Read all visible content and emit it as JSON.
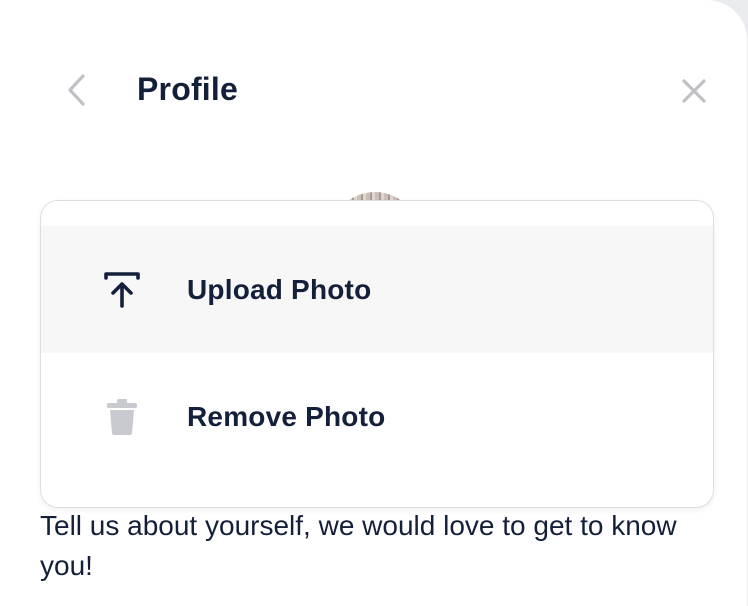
{
  "header": {
    "title": "Profile",
    "back_icon": "chevron-left-icon",
    "close_icon": "close-icon"
  },
  "photo_menu": {
    "items": [
      {
        "label": "Upload Photo",
        "icon": "upload-icon"
      },
      {
        "label": "Remove Photo",
        "icon": "trash-icon"
      }
    ]
  },
  "about": {
    "prompt": "Tell us about yourself, we would love to get to know you!"
  },
  "colors": {
    "text_primary": "#14203a",
    "icon_muted": "#bfc1c7",
    "hover_bg": "#f7f7f8",
    "border": "#dedfe3"
  }
}
